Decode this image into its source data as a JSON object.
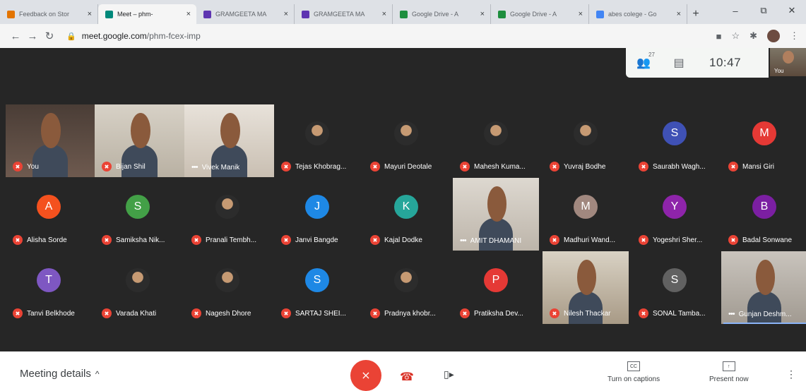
{
  "browser": {
    "tabs": [
      {
        "title": "Feedback on Stor",
        "color": "#e37400",
        "active": false
      },
      {
        "title": "Meet – phm-",
        "color": "#00897b",
        "active": true
      },
      {
        "title": "GRAMGEETA MA",
        "color": "#5e35b1",
        "active": false
      },
      {
        "title": "GRAMGEETA MA",
        "color": "#5e35b1",
        "active": false
      },
      {
        "title": "Google Drive - A",
        "color": "#1e8e3e",
        "active": false
      },
      {
        "title": "Google Drive - A",
        "color": "#1e8e3e",
        "active": false
      },
      {
        "title": "abes colege - Go",
        "color": "#4285f4",
        "active": false
      }
    ],
    "new_tab": "+",
    "url_host": "meet.google.com",
    "url_path": "/phm-fcex-imp"
  },
  "meet": {
    "participant_count": "27",
    "time": "10:47",
    "self_label": "You",
    "accent_red": "#ea4335",
    "participants": [
      {
        "name": "You",
        "kind": "video",
        "dots": false
      },
      {
        "name": "Bijan Shil",
        "kind": "video",
        "dots": false
      },
      {
        "name": "Vivek Manik",
        "kind": "video",
        "dots": true
      },
      {
        "name": "Tejas Khobrag...",
        "kind": "photo",
        "dots": false
      },
      {
        "name": "Mayuri Deotale",
        "kind": "photo",
        "dots": false
      },
      {
        "name": "Mahesh Kuma...",
        "kind": "photo",
        "dots": false
      },
      {
        "name": "Yuvraj Bodhe",
        "kind": "photo",
        "dots": false
      },
      {
        "name": "Saurabh Wagh...",
        "kind": "letter",
        "letter": "S",
        "color": "#3f51b5",
        "dots": false
      },
      {
        "name": "Mansi Giri",
        "kind": "letter",
        "letter": "M",
        "color": "#e53935",
        "dots": false
      },
      {
        "name": "Alisha Sorde",
        "kind": "letter",
        "letter": "A",
        "color": "#f4511e",
        "dots": false
      },
      {
        "name": "Samiksha Nik...",
        "kind": "letter",
        "letter": "S",
        "color": "#43a047",
        "dots": false
      },
      {
        "name": "Pranali Tembh...",
        "kind": "photo",
        "dots": false
      },
      {
        "name": "Janvi Bangde",
        "kind": "letter",
        "letter": "J",
        "color": "#1e88e5",
        "dots": false
      },
      {
        "name": "Kajal Dodke",
        "kind": "letter",
        "letter": "K",
        "color": "#26a69a",
        "dots": false
      },
      {
        "name": "AMIT DHAMANI",
        "kind": "video",
        "dots": true
      },
      {
        "name": "Madhuri Wand...",
        "kind": "letter",
        "letter": "M",
        "color": "#a1887f",
        "dots": false
      },
      {
        "name": "Yogeshri Sher...",
        "kind": "letter",
        "letter": "Y",
        "color": "#8e24aa",
        "dots": false
      },
      {
        "name": "Badal Sonwane",
        "kind": "letter",
        "letter": "B",
        "color": "#7b1fa2",
        "dots": false
      },
      {
        "name": "Tanvi Belkhode",
        "kind": "letter",
        "letter": "T",
        "color": "#7e57c2",
        "dots": false
      },
      {
        "name": "Varada Khati",
        "kind": "photo",
        "dots": false
      },
      {
        "name": "Nagesh Dhore",
        "kind": "photo",
        "dots": false
      },
      {
        "name": "SARTAJ SHEI...",
        "kind": "letter",
        "letter": "S",
        "color": "#1e88e5",
        "dots": false
      },
      {
        "name": "Pradnya khobr...",
        "kind": "photo",
        "dots": false
      },
      {
        "name": "Pratiksha Dev...",
        "kind": "letter",
        "letter": "P",
        "color": "#e53935",
        "dots": false
      },
      {
        "name": "Nilesh Thackar",
        "kind": "video",
        "dots": false
      },
      {
        "name": "SONAL Tamba...",
        "kind": "letter",
        "letter": "S",
        "color": "#616161",
        "dots": false
      },
      {
        "name": "Gunjan Deshm...",
        "kind": "video",
        "dots": true
      }
    ]
  },
  "bottom": {
    "meeting_details": "Meeting details",
    "captions": "Turn on captions",
    "present": "Present now"
  }
}
